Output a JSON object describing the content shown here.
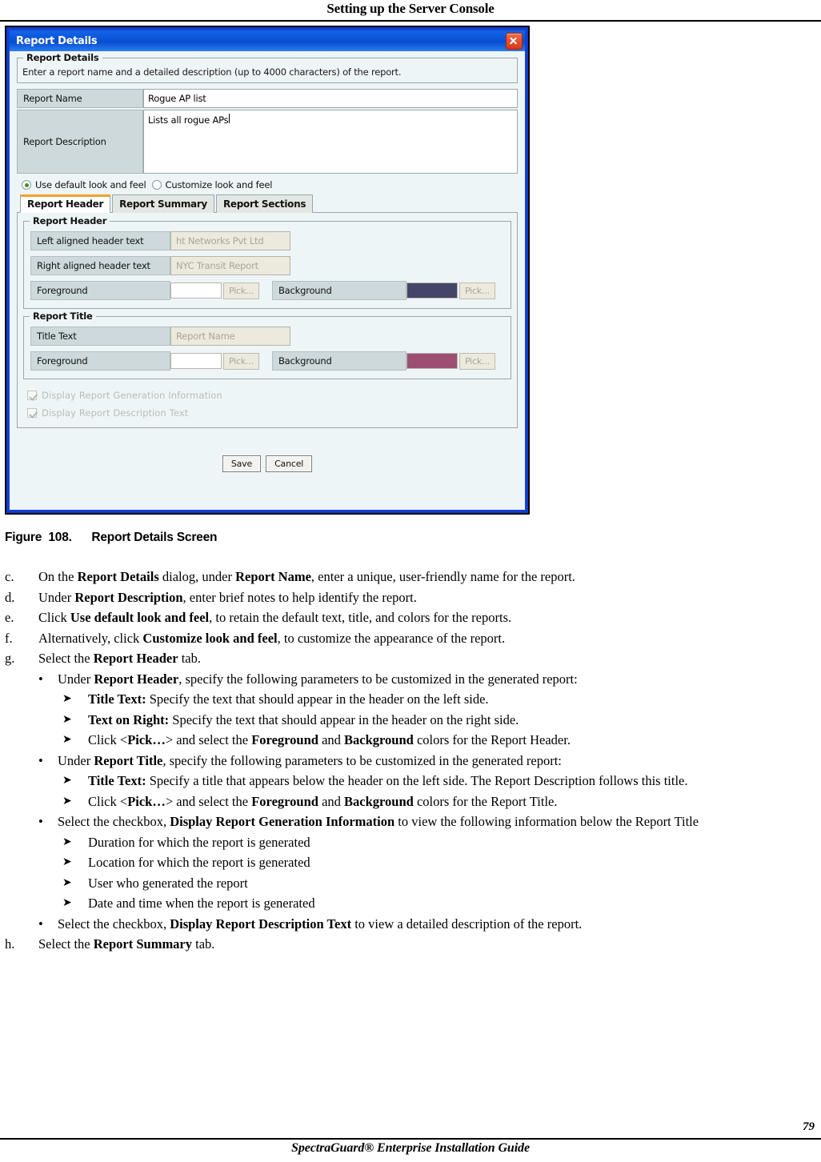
{
  "page": {
    "running_header": "Setting up the Server Console",
    "page_number": "79",
    "footer_title": "SpectraGuard® Enterprise Installation Guide"
  },
  "figure": {
    "caption_number": "Figure  108.",
    "caption_text": "Report Details Screen"
  },
  "dialog": {
    "title": "Report Details",
    "close_icon": "close-icon",
    "details_group": {
      "legend": "Report Details",
      "description": "Enter a report name and a detailed description (up to 4000 characters) of the report.",
      "name_label": "Report Name",
      "name_value": "Rogue AP list",
      "desc_label": "Report Description",
      "desc_value": "Lists all rogue APs"
    },
    "look_and_feel": {
      "default_option": "Use default look and feel",
      "custom_option": "Customize look and feel",
      "selected": "Use default look and feel"
    },
    "tabs": [
      {
        "label": "Report Header",
        "active": true
      },
      {
        "label": "Report Summary",
        "active": false
      },
      {
        "label": "Report Sections",
        "active": false
      }
    ],
    "report_header_section": {
      "legend": "Report Header",
      "left_label": "Left aligned header text",
      "left_value": "ht Networks Pvt Ltd",
      "right_label": "Right aligned header text",
      "right_value": "NYC Transit Report",
      "foreground_label": "Foreground",
      "foreground_color": "#ffffff",
      "background_label": "Background",
      "background_color": "#454569",
      "pick_label": "Pick..."
    },
    "report_title_section": {
      "legend": "Report Title",
      "title_text_label": "Title Text",
      "title_text_value": "Report Name",
      "foreground_label": "Foreground",
      "foreground_color": "#ffffff",
      "background_label": "Background",
      "background_color": "#9d4f73",
      "pick_label": "Pick..."
    },
    "checkboxes": [
      {
        "label": "Display Report Generation Information",
        "checked": true
      },
      {
        "label": "Display Report Description Text",
        "checked": true
      }
    ],
    "buttons": {
      "save": "Save",
      "cancel": "Cancel"
    }
  },
  "steps": [
    {
      "marker": "c.",
      "html": "On the <b>Report Details</b> dialog, under <b>Report Name</b>, enter a unique, user-friendly name for the report."
    },
    {
      "marker": "d.",
      "html": "Under <b>Report Description</b>, enter brief notes to help identify the report."
    },
    {
      "marker": "e.",
      "html": "Click <b>Use default look and feel</b>, to retain the default text, title, and colors for the reports."
    },
    {
      "marker": "f.",
      "html": "Alternatively, click <b>Customize look and feel</b>, to customize the appearance of the report."
    },
    {
      "marker": "g.",
      "html": "Select the <b>Report Header</b> tab."
    },
    {
      "marker": "•",
      "level": "bullet",
      "html": "Under <b>Report Header</b>, specify the following parameters to be customized in the generated report:"
    },
    {
      "marker": "➤",
      "level": "arrow",
      "html": "<b>Title Text:</b> Specify the text that should appear in the header on the left side."
    },
    {
      "marker": "➤",
      "level": "arrow",
      "html": "<b>Text on Right:</b> Specify the text that should appear in the header on the right side."
    },
    {
      "marker": "➤",
      "level": "arrow",
      "html": "Click &lt;<b>Pick…</b>&gt; and select the <b>Foreground</b> and <b>Background</b> colors for the Report Header."
    },
    {
      "marker": "•",
      "level": "bullet",
      "html": "Under <b>Report Title</b>, specify the following parameters to be customized in the generated report:"
    },
    {
      "marker": "➤",
      "level": "arrow",
      "html": "<b>Title Text:</b> Specify a title that appears below the header on the left side. The Report Description follows this title."
    },
    {
      "marker": "➤",
      "level": "arrow",
      "html": "Click &lt;<b>Pick…</b>&gt; and select the <b>Foreground</b> and <b>Background</b> colors for the Report Title."
    },
    {
      "marker": "•",
      "level": "bullet",
      "html": "Select the checkbox, <b>Display Report Generation Information</b> to view the following information below the Report Title"
    },
    {
      "marker": "➤",
      "level": "arrow",
      "html": "Duration for which the report is generated"
    },
    {
      "marker": "➤",
      "level": "arrow",
      "html": "Location for which the report is generated"
    },
    {
      "marker": "➤",
      "level": "arrow",
      "html": "User who generated the report"
    },
    {
      "marker": "➤",
      "level": "arrow",
      "html": "Date and time when the report is generated"
    },
    {
      "marker": "•",
      "level": "bullet",
      "html": "Select the checkbox, <b>Display Report Description Text</b> to view a detailed description of the report."
    },
    {
      "marker": "h.",
      "html": "Select the <b>Report Summary</b> tab."
    }
  ]
}
